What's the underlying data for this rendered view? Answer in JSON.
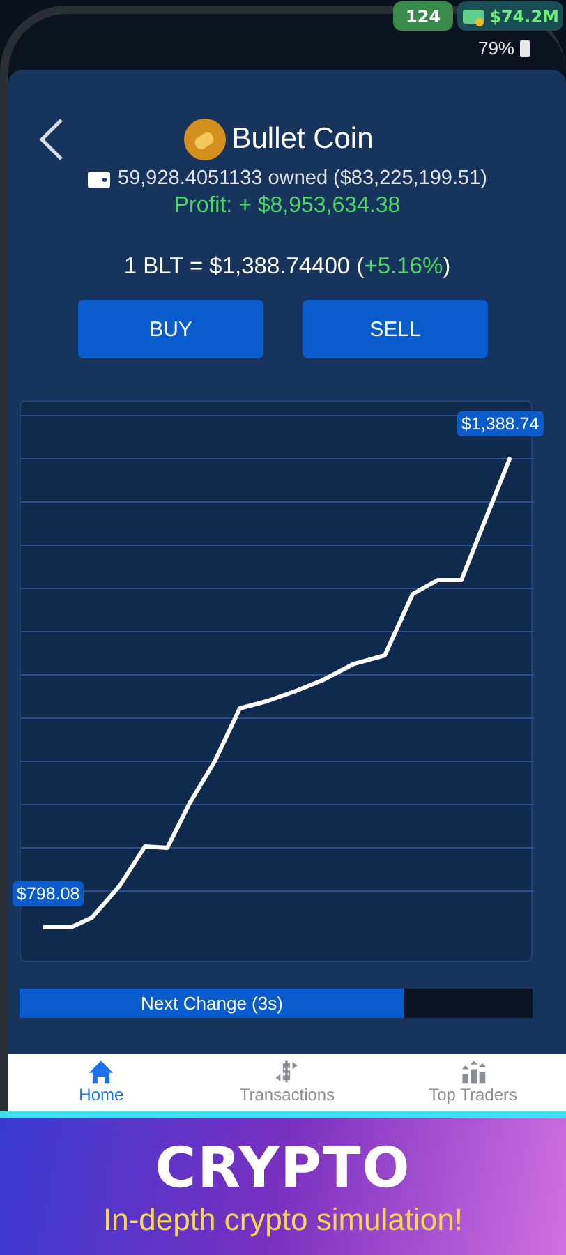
{
  "status": {
    "level_badge": "124",
    "cash": "$74.2M",
    "battery": "79%"
  },
  "coin": {
    "name": "Bullet Coin",
    "owned": "59,928.4051133 owned ($83,225,199.51)",
    "profit": "Profit: + $8,953,634.38",
    "rate_prefix": "1 BLT = $1,388.74400 (",
    "change": "+5.16%",
    "rate_suffix": ")"
  },
  "buttons": [
    {
      "label": "BUY"
    },
    {
      "label": "SELL"
    }
  ],
  "chart": {
    "start_label": "$798.08",
    "end_label": "$1,388.74"
  },
  "timer": {
    "label": "Next Change (3s)",
    "level": 0.75
  },
  "nav": [
    {
      "label": "Home",
      "kind": "home",
      "selected": true
    },
    {
      "label": "Transactions",
      "kind": "exchange",
      "selected": false
    },
    {
      "label": "Top Traders",
      "kind": "ranking",
      "selected": false
    }
  ],
  "banner": {
    "title": "CRYPTO",
    "subtitle": "In-depth crypto simulation!"
  }
}
